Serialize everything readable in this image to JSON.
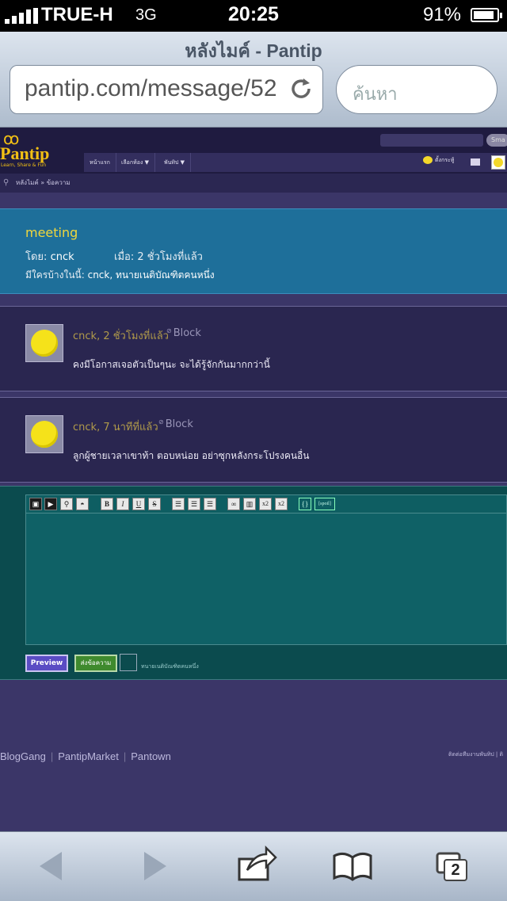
{
  "status_bar": {
    "carrier": "TRUE-H",
    "network": "3G",
    "time": "20:25",
    "battery_percent": "91%",
    "battery_level": 0.91
  },
  "browser": {
    "page_title": "หลังไมค์ - Pantip",
    "url": "pantip.com/message/52",
    "search_placeholder": "ค้นหา",
    "tab_count": "2",
    "icons": [
      "back-icon",
      "forward-icon",
      "share-icon",
      "bookmarks-icon",
      "tabs-icon",
      "reload-icon"
    ]
  },
  "site": {
    "logo_text": "Pantip",
    "logo_tagline": "Learn, Share & Fun",
    "search_button": "Sma",
    "nav": [
      {
        "label": "หน้าแรก"
      },
      {
        "label": "เลือกห้อง ▼"
      },
      {
        "label": "พันทิป ▼"
      }
    ],
    "settings_label": "ตั้งกระทู้",
    "breadcrumb": "หลังไมค์ » ข้อความ"
  },
  "topic": {
    "title": "meeting",
    "by_label": "โดย:",
    "by_user": "cnck",
    "when_label": "เมื่อ:",
    "when_value": "2 ชั่วโมงที่แล้ว",
    "participants_label": "มีใครบ้างในนี้:",
    "participants": "cnck, ทนายเนติบัณฑิตคนหนึ่ง"
  },
  "comments": [
    {
      "meta": "cnck, 2 ชั่วโมงที่แล้ว",
      "block_label": "Block",
      "message": "คงมีโอกาสเจอตัวเป็นๆนะ จะได้รู้จักกันมากกว่านี้"
    },
    {
      "meta": "cnck, 7 นาทีที่แล้ว",
      "block_label": "Block",
      "message": "ลูกผู้ชายเวลาเขาท้า ตอบหน่อย อย่าซุกหลังกระโปรงคนอื่น"
    }
  ],
  "editor": {
    "toolbar": [
      "B",
      "I",
      "U",
      "S",
      "x2",
      "x2",
      "{}",
      "[spoil]"
    ],
    "preview_label": "Preview",
    "send_label": "ส่งข้อความ",
    "post_as": "ทนายเนติบัณฑิตคนหนึ่ง"
  },
  "footer": {
    "links": [
      "BlogGang",
      "PantipMarket",
      "Pantown"
    ],
    "right_text": "ติดต่อทีมงานพันทิป | ติ"
  }
}
